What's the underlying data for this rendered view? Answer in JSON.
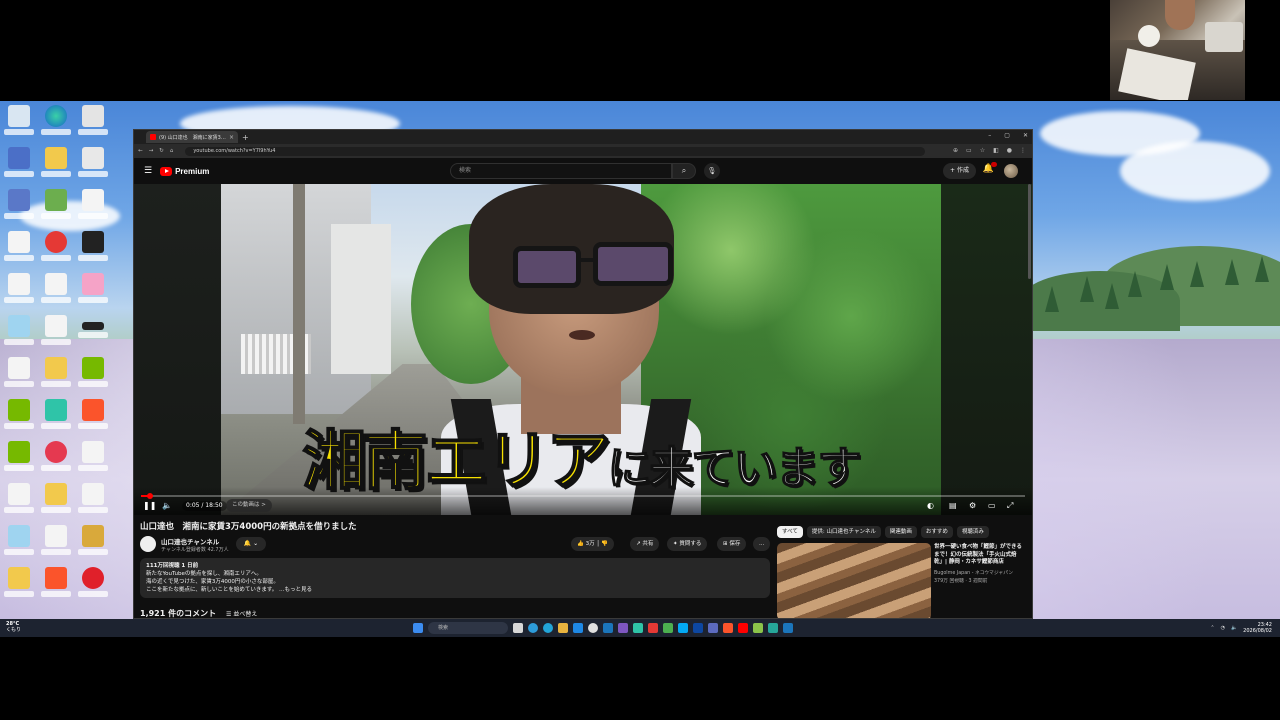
{
  "browser": {
    "tab_title": "(9) 山口達也　湘南に家賃3… ",
    "tab_close": "×",
    "new_tab": "+",
    "url": "youtube.com/watch?v=Y7l9hYu4",
    "win_min": "–",
    "win_max": "▢",
    "win_close": "✕"
  },
  "youtube": {
    "logo_text": "Premium",
    "search_placeholder": "検索",
    "create_label": "作成"
  },
  "video": {
    "caption_big": "湘南エリア",
    "caption_small": "に来ています",
    "time": "0:05 / 18:50",
    "chapter": "この動画は >",
    "progress_fraction": 0.01
  },
  "details": {
    "title": "山口達也　湘南に家賃3万4000円の新拠点を借りました",
    "channel_name": "山口達也チャンネル",
    "channel_subs": "チャンネル登録者数 42.7万人",
    "like_count": "3万",
    "share_label": "共有",
    "thanks_label": "質問する",
    "save_label": "保存",
    "more_label": "...",
    "desc_meta": "111万回視聴  1 日前",
    "desc_line1": "新たなYouTubeの拠点を探し、湘南エリアへ。",
    "desc_line2": "海の近くで見つけた、家賃3万4000円の小さな部屋。",
    "desc_line3": "ここを新たな拠点に、新しいことを始めていきます。 …もっと見る",
    "comments_count": "1,921 件のコメント",
    "sort_label": "並べ替え"
  },
  "sidebar": {
    "chips": [
      "すべて",
      "提供: 山口達也チャンネル",
      "関連動画",
      "おすすめ",
      "視聴済み"
    ],
    "rec_title": "世界一硬い食べ物「鰹節」ができるまで！幻の伝統製法「手火山式焙乾」| 静岡・カネサ鰹節商店",
    "rec_channel": "Bugolme Japan - ネコウマジャパン",
    "rec_views": "379万 回視聴 · 3 週間前"
  },
  "taskbar": {
    "temp": "28°C",
    "weather": "くもり",
    "search": "検索",
    "time": "23:42",
    "date": "2026/08/02"
  }
}
